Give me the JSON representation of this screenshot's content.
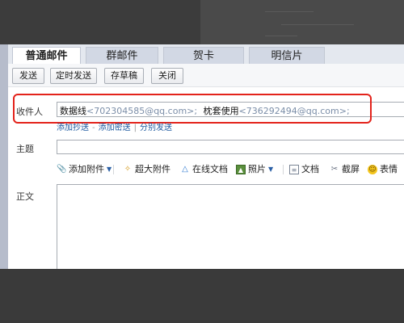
{
  "tabs": [
    "普通邮件",
    "群邮件",
    "贺卡",
    "明信片"
  ],
  "toolbar": {
    "send": "发送",
    "scheduled_send": "定时发送",
    "save_draft": "存草稿",
    "close": "关闭"
  },
  "form": {
    "recipients_label": "收件人",
    "recipients": [
      {
        "name": "数据线",
        "address": "<702304585@qq.com>;"
      },
      {
        "name": "枕套使用",
        "address": "<736292494@qq.com>;"
      }
    ],
    "add_cc": "添加抄送",
    "add_bcc": "添加密送",
    "separate_send": "分别发送",
    "link_separator": "-",
    "link_separator2": "|",
    "subject_label": "主题",
    "body_label": "正文"
  },
  "editor_tools": [
    {
      "label": "添加附件",
      "icon": "paperclip-icon"
    },
    {
      "label": "超大附件",
      "icon": "big-attachment-icon"
    },
    {
      "label": "在线文档",
      "icon": "online-doc-icon"
    },
    {
      "label": "照片",
      "icon": "photo-icon"
    },
    {
      "label": "文档",
      "icon": "document-icon"
    },
    {
      "label": "截屏",
      "icon": "screenshot-icon"
    },
    {
      "label": "表情",
      "icon": "emoji-icon"
    }
  ],
  "colors": {
    "highlight": "#e3231b",
    "link": "#1e5aa0",
    "address": "#7b8ea8"
  }
}
